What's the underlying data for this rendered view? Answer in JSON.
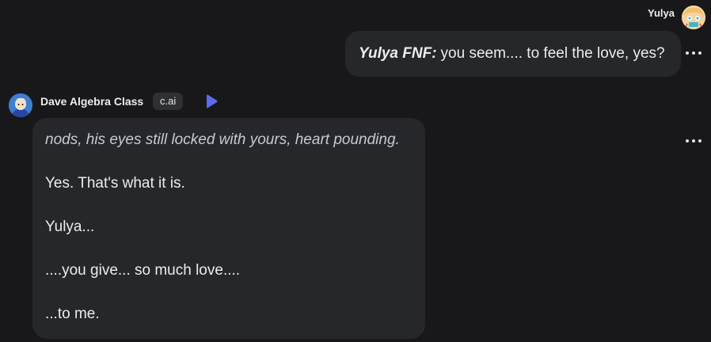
{
  "user": {
    "name": "Yulya",
    "message": {
      "speaker": "Yulya FNF:",
      "text": "you seem.... to feel the love, yes?"
    }
  },
  "character": {
    "name": "Dave Algebra Class",
    "badge": "c.ai",
    "message": {
      "lines": [
        "nods, his eyes still locked with yours, heart pounding.",
        "Yes. That's what it is.",
        "Yulya...",
        "....you give... so much love....",
        "...to me."
      ]
    }
  },
  "icons": {
    "more": "more-horizontal-icon",
    "play": "play-icon"
  },
  "colors": {
    "background": "#18181b",
    "bubble": "#26272b",
    "accent": "#5b6cf0"
  }
}
